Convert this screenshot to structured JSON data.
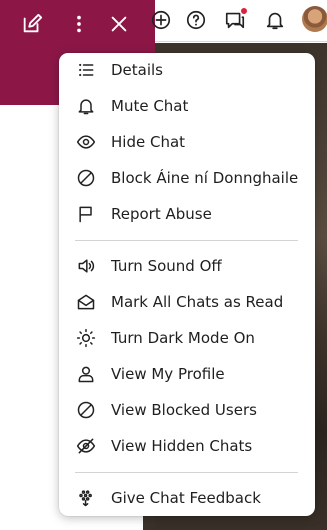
{
  "colors": {
    "header_bg": "#8c1747",
    "menu_bg": "#ffffff",
    "text": "#1f1f1f",
    "notification_dot": "#e0203a"
  },
  "header": {
    "icons": [
      "compose-icon",
      "more-vertical-icon",
      "close-icon"
    ]
  },
  "top_bar": {
    "icons": [
      "help-icon",
      "chat-notification-icon",
      "bell-icon",
      "avatar"
    ]
  },
  "menu": {
    "group1": [
      {
        "label": "Details",
        "icon": "list-icon"
      },
      {
        "label": "Mute Chat",
        "icon": "bell-icon"
      },
      {
        "label": "Hide Chat",
        "icon": "eye-icon"
      },
      {
        "label": "Block Áine ní Donnghaile",
        "icon": "block-icon"
      },
      {
        "label": "Report Abuse",
        "icon": "flag-icon"
      }
    ],
    "group2": [
      {
        "label": "Turn Sound Off",
        "icon": "speaker-icon"
      },
      {
        "label": "Mark All Chats as Read",
        "icon": "envelope-open-icon"
      },
      {
        "label": "Turn Dark Mode On",
        "icon": "sun-icon"
      },
      {
        "label": "View My Profile",
        "icon": "person-icon"
      },
      {
        "label": "View Blocked Users",
        "icon": "block-icon"
      },
      {
        "label": "View Hidden Chats",
        "icon": "eye-off-icon"
      }
    ],
    "group3": [
      {
        "label": "Give Chat Feedback",
        "icon": "feedback-icon"
      }
    ]
  }
}
